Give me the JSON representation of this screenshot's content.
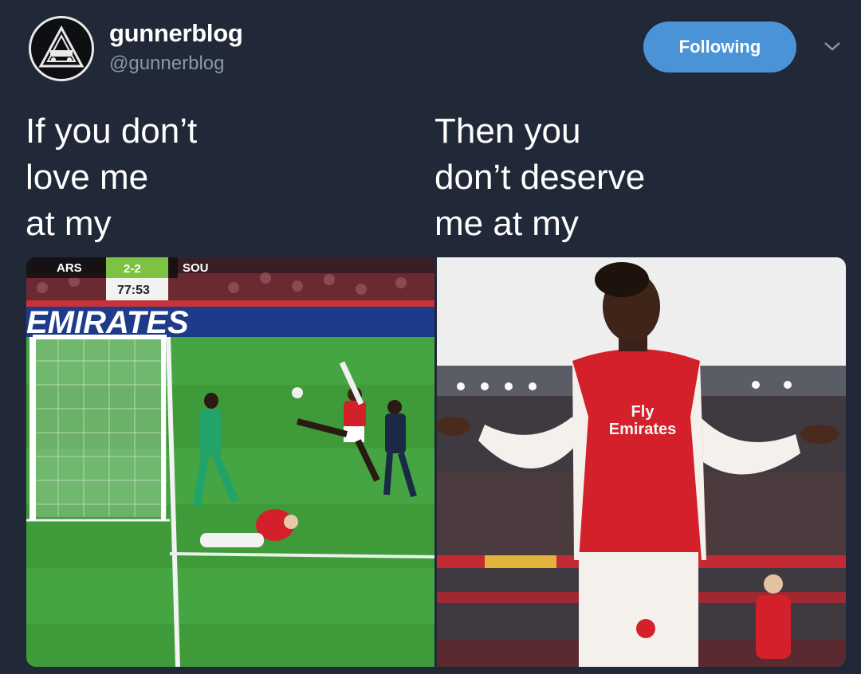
{
  "tweet": {
    "display_name": "gunnerblog",
    "handle": "@gunnerblog",
    "follow_button_label": "Following",
    "avatar_icon": "arsenal-cannon-crest-icon",
    "caret_icon": "chevron-down-icon",
    "caption_left": "If you don’t\nlove me\nat my",
    "caption_right": "Then you\ndon’t deserve\nme at my"
  },
  "media": {
    "left_image": {
      "description": "football-match-goal-scene",
      "scoreboard": {
        "home": "ARS",
        "score": "2-2",
        "away": "SOU",
        "clock": "77:53"
      },
      "board_text": "EMIRATES"
    },
    "right_image": {
      "description": "player-celebrating-shrug",
      "shirt_sponsor": "Fly\nEmirates"
    }
  },
  "colors": {
    "background": "#212838",
    "follow_button": "#4a93d6",
    "handle_text": "#8899a6",
    "arsenal_red": "#d4202a",
    "pitch_green": "#3f9b3a",
    "scoreboard_green": "#7dc243"
  }
}
